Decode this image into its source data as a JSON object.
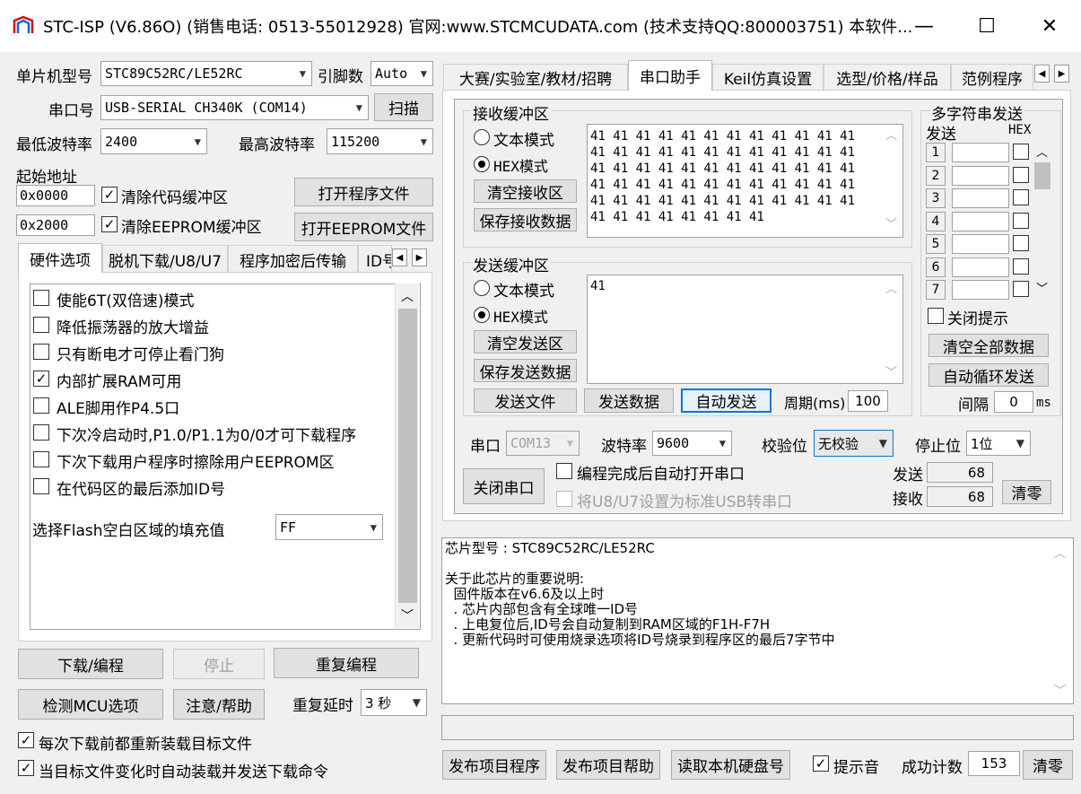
{
  "window": {
    "title": "STC-ISP (V6.86O) (销售电话: 0513-55012928) 官网:www.STCMCUDATA.com  (技术支持QQ:800003751) 本软件...",
    "minimize": "—",
    "maximize": "☐",
    "close": "✕"
  },
  "mcu": {
    "model_label": "单片机型号",
    "model_value": "STC89C52RC/LE52RC",
    "pins_label": "引脚数",
    "pins_value": "Auto",
    "port_label": "串口号",
    "port_value": "USB-SERIAL CH340K (COM14)",
    "scan_button": "扫描",
    "min_baud_label": "最低波特率",
    "min_baud_value": "2400",
    "max_baud_label": "最高波特率",
    "max_baud_value": "115200",
    "start_addr_label": "起始地址",
    "code_addr": "0x0000",
    "clear_code_label": "清除代码缓冲区",
    "open_program_button": "打开程序文件",
    "eeprom_addr": "0x2000",
    "clear_eeprom_label": "清除EEPROM缓冲区",
    "open_eeprom_button": "打开EEPROM文件"
  },
  "left_tabs": [
    "硬件选项",
    "脱机下载/U8/U7",
    "程序加密后传输",
    "ID号"
  ],
  "hardware_options": [
    {
      "label": "使能6T(双倍速)模式",
      "checked": false
    },
    {
      "label": "降低振荡器的放大增益",
      "checked": false
    },
    {
      "label": "只有断电才可停止看门狗",
      "checked": false
    },
    {
      "label": "内部扩展RAM可用",
      "checked": true
    },
    {
      "label": "ALE脚用作P4.5口",
      "checked": false
    },
    {
      "label": "下次冷启动时,P1.0/P1.1为0/0才可下载程序",
      "checked": false
    },
    {
      "label": "下次下载用户程序时擦除用户EEPROM区",
      "checked": false
    },
    {
      "label": "在代码区的最后添加ID号",
      "checked": false
    }
  ],
  "flash_fill": {
    "label": "选择Flash空白区域的填充值",
    "value": "FF"
  },
  "bottom_left": {
    "download_button": "下载/编程",
    "stop_button": "停止",
    "reprogram_button": "重复编程",
    "detect_button": "检测MCU选项",
    "help_button": "注意/帮助",
    "delay_label": "重复延时",
    "delay_value": "3 秒",
    "reload_label": "每次下载前都重新装载目标文件",
    "autoload_label": "当目标文件变化时自动装载并发送下载命令"
  },
  "right_tabs": [
    "大赛/实验室/教材/招聘",
    "串口助手",
    "Keil仿真设置",
    "选型/价格/样品",
    "范例程序"
  ],
  "receive": {
    "title": "接收缓冲区",
    "text_mode": "文本模式",
    "hex_mode": "HEX模式",
    "clear_button": "清空接收区",
    "save_button": "保存接收数据",
    "lines": [
      "41 41 41 41 41 41 41 41 41 41 41 41",
      "41 41 41 41 41 41 41 41 41 41 41 41",
      "41 41 41 41 41 41 41 41 41 41 41 41",
      "41 41 41 41 41 41 41 41 41 41 41 41",
      "41 41 41 41 41 41 41 41 41 41 41 41",
      "41 41 41 41 41 41 41 41"
    ]
  },
  "send": {
    "title": "发送缓冲区",
    "text_mode": "文本模式",
    "hex_mode": "HEX模式",
    "clear_button": "清空发送区",
    "save_button": "保存发送数据",
    "content": "41",
    "send_file_button": "发送文件",
    "send_data_button": "发送数据",
    "auto_send_button": "自动发送",
    "period_label": "周期(ms)",
    "period_value": "100"
  },
  "multi": {
    "title": "多字符串发送",
    "send_header": "发送",
    "hex_header": "HEX",
    "rows": [
      "1",
      "2",
      "3",
      "4",
      "5",
      "6",
      "7"
    ],
    "close_hint_label": "关闭提示",
    "clear_all_button": "清空全部数据",
    "auto_loop_button": "自动循环发送",
    "interval_label": "间隔",
    "interval_value": "0",
    "interval_unit": "ms"
  },
  "serial": {
    "port_label": "串口",
    "port_value": "COM13",
    "baud_label": "波特率",
    "baud_value": "9600",
    "parity_label": "校验位",
    "parity_value": "无校验",
    "stop_label": "停止位",
    "stop_value": "1位",
    "close_port_button": "关闭串口",
    "auto_open_label": "编程完成后自动打开串口",
    "usb_label": "将U8/U7设置为标准USB转串口",
    "sent_label": "发送",
    "sent_value": "68",
    "recv_label": "接收",
    "recv_value": "68",
    "clear_button": "清零"
  },
  "info": {
    "lines": [
      "芯片型号 : STC89C52RC/LE52RC",
      "",
      "关于此芯片的重要说明:",
      "  固件版本在v6.6及以上时",
      "  . 芯片内部包含有全球唯一ID号",
      "  . 上电复位后,ID号会自动复制到RAM区域的F1H-F7H",
      "  . 更新代码时可使用烧录选项将ID号烧录到程序区的最后7字节中"
    ]
  },
  "footer": {
    "publish_program_button": "发布项目程序",
    "publish_help_button": "发布项目帮助",
    "read_disk_button": "读取本机硬盘号",
    "sound_label": "提示音",
    "success_label": "成功计数",
    "success_value": "153",
    "clear_button": "清零"
  }
}
